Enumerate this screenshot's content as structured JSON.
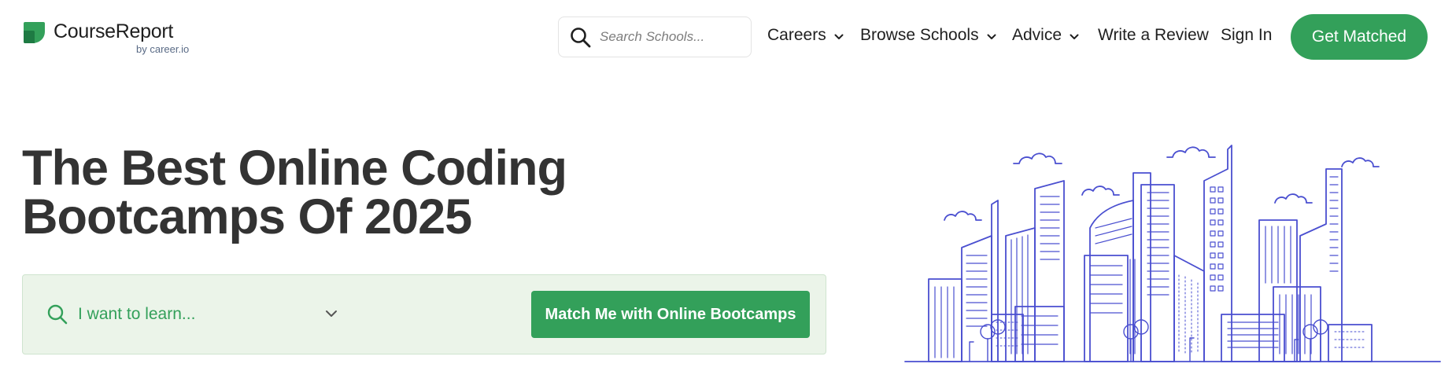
{
  "header": {
    "logo_text": "CourseReport",
    "logo_sub": "by career.io",
    "search_placeholder": "Search Schools...",
    "nav": {
      "careers": "Careers",
      "browse_schools": "Browse Schools",
      "advice": "Advice",
      "write_review": "Write a Review",
      "sign_in": "Sign In"
    },
    "cta_label": "Get Matched"
  },
  "hero": {
    "title_line1": "The Best Online Coding",
    "title_line2": "Bootcamps Of 2025",
    "learn_placeholder": "I want to learn...",
    "match_button": "Match Me with Online Bootcamps"
  },
  "icons": {
    "logo": "coursereport-leaf-logo-icon",
    "search": "search-icon",
    "chevron": "chevron-down-icon",
    "illustration": "city-skyline-illustration"
  },
  "colors": {
    "brand_green": "#33a05a",
    "panel_bg": "#ebf4e9",
    "illustration_stroke": "#4a4fd0",
    "title_text": "#333333"
  }
}
